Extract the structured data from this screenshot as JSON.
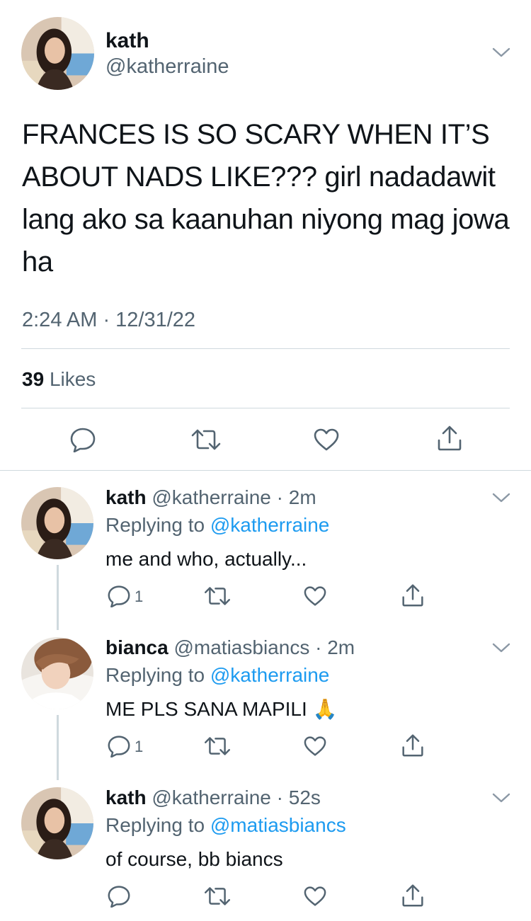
{
  "main_tweet": {
    "display_name": "kath",
    "handle": "@katherraine",
    "text": "FRANCES IS SO SCARY WHEN IT’S ABOUT NADS LIKE??? girl nadadawit lang ako sa kaanuhan niyong mag jowa ha",
    "timestamp": "2:24 AM · 12/31/22",
    "likes_count": "39",
    "likes_label": "Likes"
  },
  "replies": [
    {
      "display_name": "kath",
      "handle_time": "@katherraine · 2m",
      "replying_label": "Replying to",
      "replying_to": "@katherraine",
      "text": "me and who, actually...",
      "reply_count": "1"
    },
    {
      "display_name": "bianca",
      "handle_time": "@matiasbiancs · 2m",
      "replying_label": "Replying to",
      "replying_to": "@katherraine",
      "text": "ME PLS SANA MAPILI 🙏",
      "reply_count": "1"
    },
    {
      "display_name": "kath",
      "handle_time": "@katherraine · 52s",
      "replying_label": "Replying to",
      "replying_to": "@matiasbiancs",
      "text": "of course, bb biancs",
      "reply_count": ""
    }
  ],
  "icons": {
    "reply": "reply-icon",
    "retweet": "retweet-icon",
    "like": "like-icon",
    "share": "share-icon",
    "more": "chevron-down-icon"
  },
  "colors": {
    "text": "#0f1419",
    "secondary": "#536471",
    "link": "#1d9bf0",
    "divider": "#cfd9de"
  }
}
